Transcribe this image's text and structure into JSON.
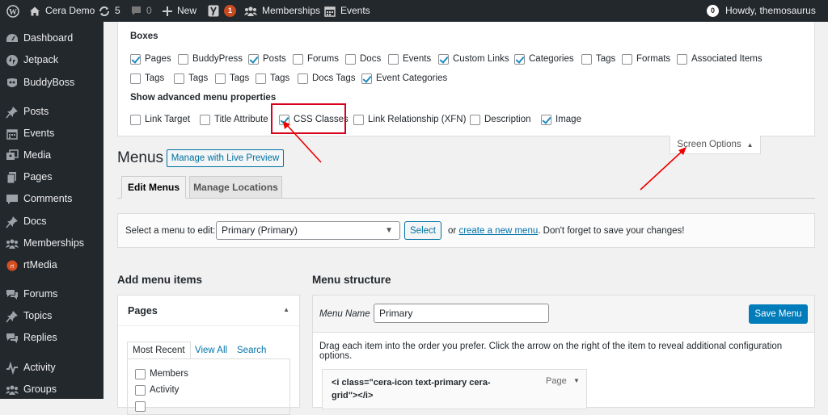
{
  "admin_bar": {
    "site_name": "Cera Demo",
    "updates_count": "5",
    "comments_count": "0",
    "new_label": "New",
    "yoast_badge": "1",
    "memberships_label": "Memberships",
    "events_label": "Events",
    "notifications_count": "0",
    "howdy": "Howdy, themosaurus"
  },
  "sidebar": {
    "items": [
      {
        "label": "Dashboard",
        "icon": "dashboard-icon"
      },
      {
        "label": "Jetpack",
        "icon": "jetpack-icon"
      },
      {
        "label": "BuddyBoss",
        "icon": "buddyboss-icon"
      },
      {
        "label": "Posts",
        "icon": "pin-icon"
      },
      {
        "label": "Events",
        "icon": "calendar-icon"
      },
      {
        "label": "Media",
        "icon": "media-icon"
      },
      {
        "label": "Pages",
        "icon": "pages-icon"
      },
      {
        "label": "Comments",
        "icon": "comment-icon"
      },
      {
        "label": "Docs",
        "icon": "pin-icon"
      },
      {
        "label": "Memberships",
        "icon": "groups-icon"
      },
      {
        "label": "rtMedia",
        "icon": "rtmedia-icon"
      },
      {
        "label": "Forums",
        "icon": "forums-icon"
      },
      {
        "label": "Topics",
        "icon": "topics-icon"
      },
      {
        "label": "Replies",
        "icon": "replies-icon"
      },
      {
        "label": "Activity",
        "icon": "activity-icon"
      },
      {
        "label": "Groups",
        "icon": "groups-icon"
      }
    ]
  },
  "screen_options": {
    "boxes_heading": "Boxes",
    "boxes": [
      {
        "label": "Pages",
        "checked": true
      },
      {
        "label": "BuddyPress",
        "checked": false
      },
      {
        "label": "Posts",
        "checked": true
      },
      {
        "label": "Forums",
        "checked": false
      },
      {
        "label": "Docs",
        "checked": false
      },
      {
        "label": "Events",
        "checked": false
      },
      {
        "label": "Custom Links",
        "checked": true
      },
      {
        "label": "Categories",
        "checked": true
      },
      {
        "label": "Tags",
        "checked": false
      },
      {
        "label": "Formats",
        "checked": false
      },
      {
        "label": "Associated Items",
        "checked": false
      },
      {
        "label": "Tags",
        "checked": false
      },
      {
        "label": "Tags",
        "checked": false
      },
      {
        "label": "Tags",
        "checked": false
      },
      {
        "label": "Tags",
        "checked": false
      },
      {
        "label": "Docs Tags",
        "checked": false
      },
      {
        "label": "Event Categories",
        "checked": true
      }
    ],
    "advanced_heading": "Show advanced menu properties",
    "advanced": [
      {
        "label": "Link Target",
        "checked": false
      },
      {
        "label": "Title Attribute",
        "checked": false
      },
      {
        "label": "CSS Classes",
        "checked": true
      },
      {
        "label": "Link Relationship (XFN)",
        "checked": false
      },
      {
        "label": "Description",
        "checked": false
      },
      {
        "label": "Image",
        "checked": true
      }
    ],
    "toggle_label": "Screen Options"
  },
  "page": {
    "title": "Menus",
    "live_preview": "Manage with Live Preview",
    "tabs": [
      "Edit Menus",
      "Manage Locations"
    ],
    "select_label": "Select a menu to edit:",
    "selected_menu": "Primary (Primary)",
    "select_button": "Select",
    "or_text": "or",
    "create_link": "create a new menu",
    "save_hint": ". Don't forget to save your changes!"
  },
  "add_items": {
    "heading": "Add menu items",
    "box_title": "Pages",
    "tabs": [
      "Most Recent",
      "View All",
      "Search"
    ],
    "items": [
      "Members",
      "Activity"
    ]
  },
  "structure": {
    "heading": "Menu structure",
    "menu_name_label": "Menu Name",
    "menu_name_value": "Primary",
    "save_button": "Save Menu",
    "instructions": "Drag each item into the order you prefer. Click the arrow on the right of the item to reveal additional configuration options.",
    "item_title": "<i class=\"cera-icon text-primary cera-grid\"></i>",
    "item_type": "Page"
  },
  "colors": {
    "admin_bg": "#23282d",
    "primary_blue": "#007cba",
    "link_blue": "#0073aa",
    "highlight_red": "#d8001c"
  }
}
